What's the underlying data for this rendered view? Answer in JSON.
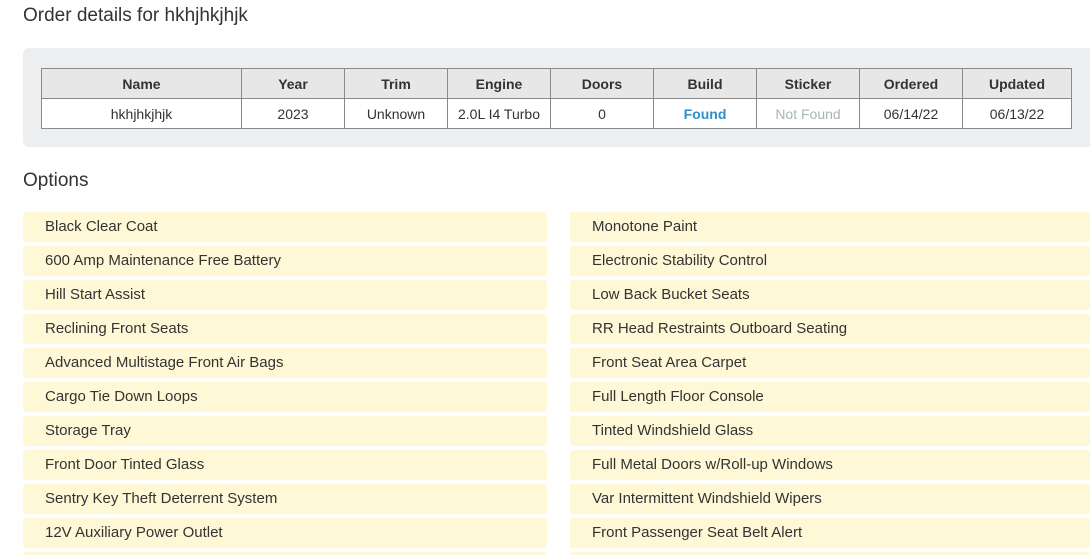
{
  "page": {
    "title": "Order details for hkhjhkjhjk"
  },
  "order_table": {
    "headers": [
      "Name",
      "Year",
      "Trim",
      "Engine",
      "Doors",
      "Build",
      "Sticker",
      "Ordered",
      "Updated"
    ],
    "row": {
      "name": "hkhjhkjhjk",
      "year": "2023",
      "trim": "Unknown",
      "engine": "2.0L I4 Turbo",
      "doors": "0",
      "build": "Found",
      "sticker": "Not Found",
      "ordered": "06/14/22",
      "updated": "06/13/22"
    }
  },
  "options": {
    "title": "Options",
    "left": [
      "Black Clear Coat",
      "600 Amp Maintenance Free Battery",
      "Hill Start Assist",
      "Reclining Front Seats",
      "Advanced Multistage Front Air Bags",
      "Cargo Tie Down Loops",
      "Storage Tray",
      "Front Door Tinted Glass",
      "Sentry Key Theft Deterrent System",
      "12V Auxiliary Power Outlet"
    ],
    "right": [
      "Monotone Paint",
      "Electronic Stability Control",
      "Low Back Bucket Seats",
      "RR Head Restraints Outboard Seating",
      "Front Seat Area Carpet",
      "Full Length Floor Console",
      "Tinted Windshield Glass",
      "Full Metal Doors w/Roll-up Windows",
      "Var Intermittent Windshield Wipers",
      "Front Passenger Seat Belt Alert"
    ]
  },
  "colors": {
    "found": "#2e8fc9",
    "not_found": "#a9b5b5",
    "option_bg": "#fff8d6",
    "panel_bg": "#eceef0"
  }
}
